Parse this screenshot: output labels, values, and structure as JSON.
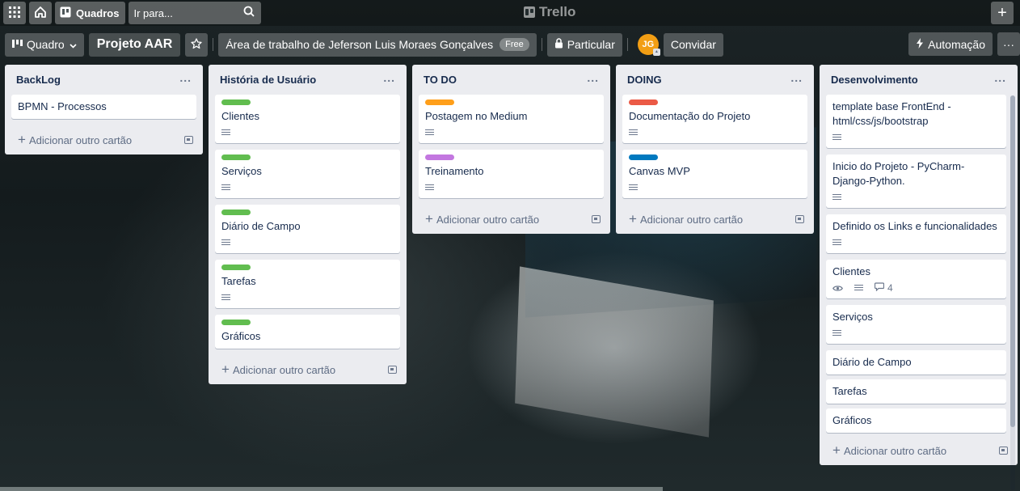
{
  "header": {
    "apps_icon": "grid-icon",
    "home_icon": "home-icon",
    "boards_label": "Quadros",
    "search_placeholder": "Ir para...",
    "logo_text": "Trello",
    "create_icon": "plus-icon"
  },
  "board": {
    "view_label": "Quadro",
    "title": "Projeto AAR",
    "workspace": "Área de trabalho de Jeferson Luis Moraes Gonçalves",
    "workspace_badge": "Free",
    "visibility": "Particular",
    "avatar_initials": "JG",
    "invite_label": "Convidar",
    "automation_label": "Automação",
    "more_label": "···"
  },
  "lists": [
    {
      "title": "BackLog",
      "add_label": "Adicionar outro cartão",
      "cards": [
        {
          "title": "BPMN - Processos"
        }
      ]
    },
    {
      "title": "História de Usuário",
      "add_label": "Adicionar outro cartão",
      "cards": [
        {
          "title": "Clientes",
          "label_color": "#61bd4f"
        },
        {
          "title": "Serviços",
          "label_color": "#61bd4f"
        },
        {
          "title": "Diário de Campo",
          "label_color": "#61bd4f"
        },
        {
          "title": "Tarefas",
          "label_color": "#61bd4f"
        },
        {
          "title": "Gráficos",
          "label_color": "#61bd4f"
        }
      ]
    },
    {
      "title": "TO DO",
      "add_label": "Adicionar outro cartão",
      "cards": [
        {
          "title": "Postagem no Medium",
          "label_color": "#ff9f1a"
        },
        {
          "title": "Treinamento",
          "label_color": "#c377e0"
        }
      ]
    },
    {
      "title": "DOING",
      "add_label": "Adicionar outro cartão",
      "cards": [
        {
          "title": "Documentação do Projeto",
          "label_color": "#eb5a46"
        },
        {
          "title": "Canvas MVP",
          "label_color": "#0079bf"
        }
      ]
    },
    {
      "title": "Desenvolvimento",
      "add_label": "Adicionar outro cartão",
      "cards": [
        {
          "title": "template base FrontEnd - html/css/js/bootstrap"
        },
        {
          "title": "Inicio do Projeto - PyCharm-Django-Python."
        },
        {
          "title": "Definido os Links e funcionalidades"
        },
        {
          "title": "Clientes",
          "comments": "4"
        },
        {
          "title": "Serviços"
        },
        {
          "title": "Diário de Campo"
        },
        {
          "title": "Tarefas"
        },
        {
          "title": "Gráficos"
        }
      ]
    }
  ]
}
